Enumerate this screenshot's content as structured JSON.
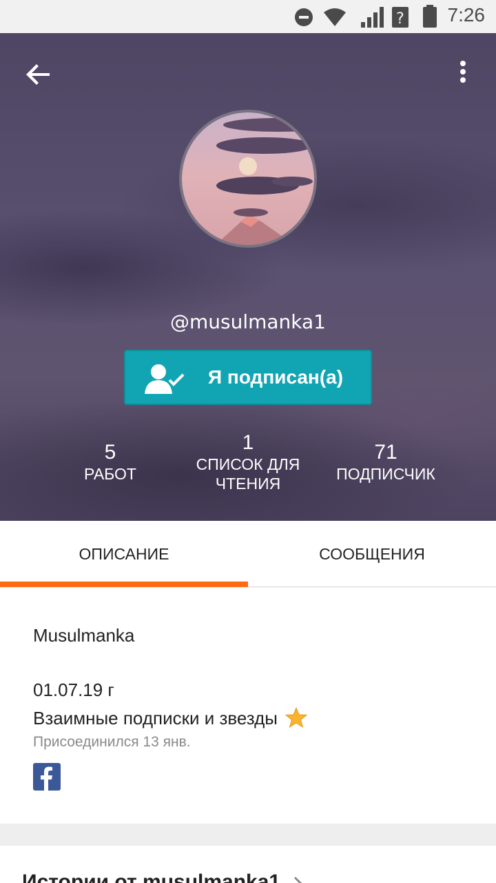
{
  "status_bar": {
    "time": "7:26",
    "icons": [
      "do-not-disturb-icon",
      "wifi-icon",
      "signal-icon",
      "battery-icon"
    ]
  },
  "header": {
    "back_icon": "arrow-left-icon",
    "menu_icon": "more-vert-icon",
    "username": "@musulmanka1",
    "follow_button": {
      "label": "Я подписан(а)",
      "icon": "user-check-icon",
      "color": "#11a5b3"
    },
    "stats": [
      {
        "value": "5",
        "label": "РАБОТ"
      },
      {
        "value": "1",
        "label_line1": "СПИСОК ДЛЯ",
        "label_line2": "ЧТЕНИЯ"
      },
      {
        "value": "71",
        "label": "ПОДПИСЧИК"
      }
    ]
  },
  "tabs": {
    "items": [
      {
        "label": "ОПИСАНИЕ",
        "active": true
      },
      {
        "label": "СООБЩЕНИЯ",
        "active": false
      }
    ],
    "accent_color": "#ff6a13"
  },
  "about": {
    "name": "Musulmanka",
    "description_line1": "01.07.19 г",
    "description_line2": "Взаимные подписки и звезды",
    "description_emoji": "star-icon",
    "joined": "Присоединился 13 янв.",
    "social_icon": "facebook-icon"
  },
  "stories": {
    "title": "Истории от musulmanka1"
  }
}
